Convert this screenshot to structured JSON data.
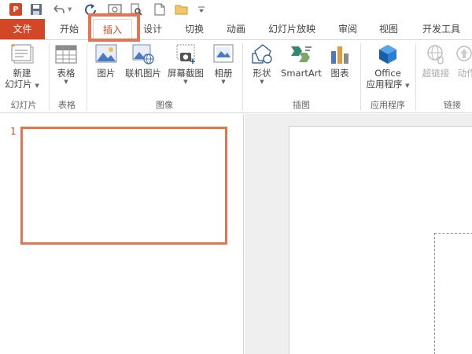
{
  "app": {
    "logo_letter": "P"
  },
  "quick_access": {
    "icons": [
      "powerpoint-logo",
      "save-icon",
      "undo-icon",
      "redo-icon",
      "present-icon",
      "print-preview-icon",
      "new-icon",
      "open-icon",
      "customize-icon"
    ]
  },
  "tabs": {
    "file": "文件",
    "home": "开始",
    "insert": "插入",
    "design": "设计",
    "transitions": "切换",
    "animations": "动画",
    "slideshow": "幻灯片放映",
    "review": "审阅",
    "view": "视图",
    "developer": "开发工具"
  },
  "ribbon": {
    "slides": {
      "new_slide_line1": "新建",
      "new_slide_line2": "幻灯片",
      "group": "幻灯片"
    },
    "tables": {
      "table": "表格",
      "group": "表格"
    },
    "images": {
      "picture": "图片",
      "online_picture": "联机图片",
      "screenshot": "屏幕截图",
      "album": "相册",
      "group": "图像"
    },
    "illustrations": {
      "shapes": "形状",
      "smartart": "SmartArt",
      "chart": "图表",
      "group": "插图"
    },
    "apps": {
      "office_line1": "Office",
      "office_line2": "应用程序",
      "group": "应用程序"
    },
    "links": {
      "hyperlink": "超链接",
      "action": "动作",
      "group": "链接"
    }
  },
  "thumbnails": {
    "slide_number": "1"
  },
  "colors": {
    "accent": "#d24726",
    "highlight": "#e8734f"
  }
}
